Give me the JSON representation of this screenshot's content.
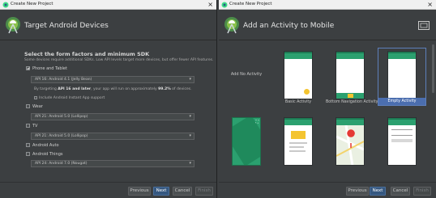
{
  "left_window": {
    "title": "Create New Project",
    "heading": "Target Android Devices",
    "section_title": "Select the form factors and minimum SDK",
    "section_desc": "Some devices require additional SDKs. Low API levels target more devices, but offer fewer API features.",
    "form_factors": [
      {
        "label": "Phone and Tablet",
        "checked": true,
        "dropdown": "API 16: Android 4.1 (Jelly Bean)"
      },
      {
        "label": "Wear",
        "checked": false,
        "dropdown": "API 21: Android 5.0 (Lollipop)"
      },
      {
        "label": "TV",
        "checked": false,
        "dropdown": "API 21: Android 5.0 (Lollipop)"
      },
      {
        "label": "Android Auto",
        "checked": false
      },
      {
        "label": "Android Things",
        "checked": false,
        "dropdown": "API 24: Android 7.0 (Nougat)"
      }
    ],
    "info_prefix": "By targeting ",
    "info_api": "API 16 and later",
    "info_mid": ", your app will run on approximately ",
    "info_percent": "99.2%",
    "info_suffix": " of devices.",
    "instant_app_label": "Include Android Instant App support",
    "buttons": {
      "previous": "Previous",
      "next": "Next",
      "cancel": "Cancel",
      "finish": "Finish"
    }
  },
  "right_window": {
    "title": "Create New Project",
    "heading": "Add an Activity to Mobile",
    "tiles": [
      {
        "label": "Add No Activity"
      },
      {
        "label": "Basic Activity"
      },
      {
        "label": "Bottom Navigation Activity"
      },
      {
        "label": "Empty Activity",
        "selected": true
      },
      {
        "label": ""
      },
      {
        "label": ""
      },
      {
        "label": ""
      },
      {
        "label": ""
      }
    ],
    "buttons": {
      "previous": "Previous",
      "next": "Next",
      "cancel": "Cancel",
      "finish": "Finish"
    }
  },
  "colors": {
    "background": "#3c3f41",
    "accent_green": "#2ba06f",
    "selection_blue": "#4b6eaf",
    "fab_yellow": "#f4c430"
  }
}
